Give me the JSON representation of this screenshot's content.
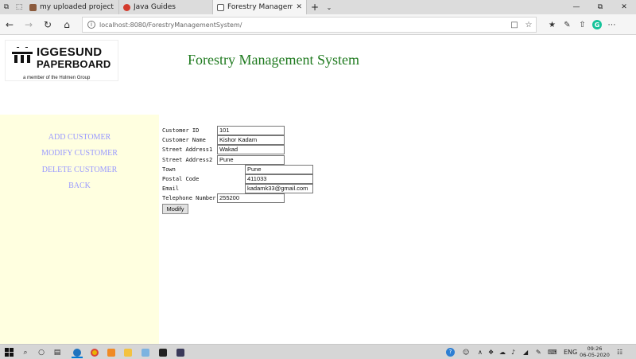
{
  "browser": {
    "tabs": [
      {
        "title": "my uploaded project list.do",
        "favicon_color": "#8b5a3c"
      },
      {
        "title": "Java Guides",
        "favicon_color": "#d33a2c"
      },
      {
        "title": "Forestry Management S",
        "favicon_color": "#555555"
      }
    ],
    "url": "localhost:8080/ForestryManagementSystem/"
  },
  "page": {
    "logo": {
      "line1": "IGGESUND",
      "line2": "PAPERBOARD",
      "tagline": "a member of the Holmen Group"
    },
    "title": "Forestry Management System",
    "menu": [
      {
        "label": "ADD CUSTOMER"
      },
      {
        "label": "MODIFY CUSTOMER"
      },
      {
        "label": "DELETE CUSTOMER"
      },
      {
        "label": "BACK"
      }
    ],
    "form": {
      "fields": [
        {
          "label": "Customer ID",
          "value": "101"
        },
        {
          "label": "Customer Name",
          "value": "Kishor Kadam"
        },
        {
          "label": "Street Address1",
          "value": "Wakad"
        },
        {
          "label": "Street Address2",
          "value": "Pune"
        },
        {
          "label": "Town",
          "value": "Pune"
        },
        {
          "label": "Postal Code",
          "value": "411033"
        },
        {
          "label": "Email",
          "value": "kadamk33@gmail.com"
        },
        {
          "label": "Telephone Number",
          "value": "255200"
        }
      ],
      "submit_label": "Modify"
    },
    "colors": {
      "title": "#1f7a1f",
      "sidebar_bg": "#ffffe0",
      "menu_link": "#9999ff"
    }
  },
  "taskbar": {
    "language": "ENG",
    "time": "09:26",
    "date": "06-05-2020"
  }
}
